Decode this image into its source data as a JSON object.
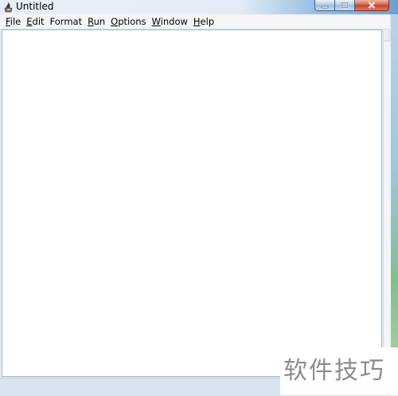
{
  "window": {
    "title": "Untitled",
    "icon": "python-idle-icon"
  },
  "menu": {
    "items": [
      {
        "mnemonic": "F",
        "rest": "ile"
      },
      {
        "mnemonic": "E",
        "rest": "dit"
      },
      {
        "mnemonic": "",
        "rest": "Format"
      },
      {
        "mnemonic": "R",
        "rest": "un"
      },
      {
        "mnemonic": "O",
        "rest": "ptions"
      },
      {
        "mnemonic": "W",
        "rest": "indow"
      },
      {
        "mnemonic": "H",
        "rest": "elp"
      }
    ]
  },
  "editor": {
    "content": ""
  },
  "watermark": {
    "text": "软件技巧"
  },
  "colors": {
    "menu_bg": "#f5f5f5",
    "editor_bg": "#ffffff",
    "close_button": "#c6412a"
  }
}
